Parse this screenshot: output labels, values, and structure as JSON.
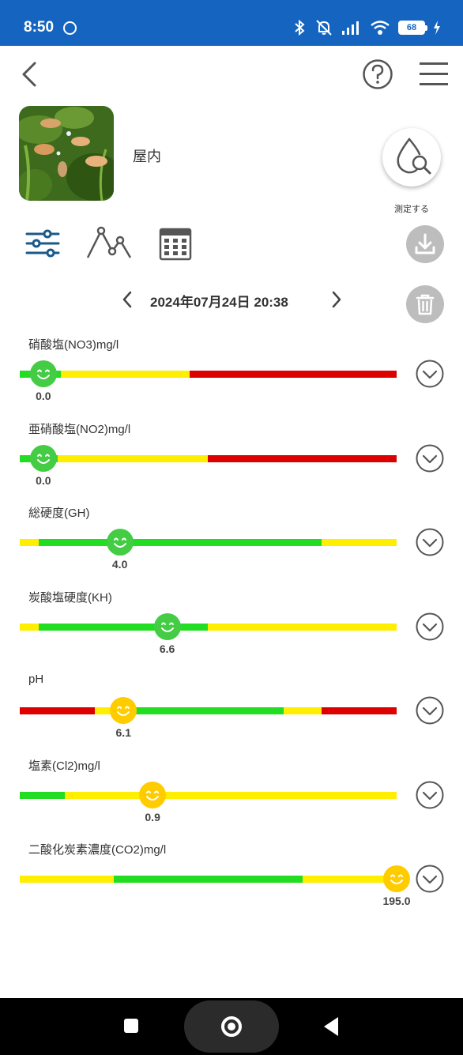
{
  "status_bar": {
    "time": "8:50",
    "battery": "68"
  },
  "header": {
    "tank_name": "屋内",
    "measure_label": "測定する"
  },
  "date_nav": {
    "datetime": "2024年07月24日 20:38"
  },
  "colors": {
    "status_bar": "#1565c0",
    "green": "#22dd22",
    "yellow": "#ffee00",
    "red": "#dd0000",
    "accent_blue": "#1a5a8a",
    "good_knob": "#44cc44",
    "ok_knob": "#ffcc00"
  },
  "params": [
    {
      "label": "硝酸塩(NO3)mg/l",
      "value": "0.0",
      "position": 0.03,
      "status": "good",
      "segments": [
        {
          "color": "green",
          "size": 0.11
        },
        {
          "color": "yellow",
          "size": 0.34
        },
        {
          "color": "red",
          "size": 0.55
        }
      ]
    },
    {
      "label": "亜硝酸塩(NO2)mg/l",
      "value": "0.0",
      "position": 0.03,
      "status": "good",
      "segments": [
        {
          "color": "green",
          "size": 0.1
        },
        {
          "color": "yellow",
          "size": 0.4
        },
        {
          "color": "red",
          "size": 0.5
        }
      ]
    },
    {
      "label": "総硬度(GH)",
      "value": "4.0",
      "position": 0.24,
      "status": "good",
      "segments": [
        {
          "color": "yellow",
          "size": 0.05
        },
        {
          "color": "green",
          "size": 0.75
        },
        {
          "color": "yellow",
          "size": 0.2
        }
      ]
    },
    {
      "label": "炭酸塩硬度(KH)",
      "value": "6.6",
      "position": 0.37,
      "status": "good",
      "segments": [
        {
          "color": "yellow",
          "size": 0.05
        },
        {
          "color": "green",
          "size": 0.45
        },
        {
          "color": "yellow",
          "size": 0.5
        }
      ]
    },
    {
      "label": "pH",
      "value": "6.1",
      "position": 0.25,
      "status": "ok",
      "segments": [
        {
          "color": "red",
          "size": 0.2
        },
        {
          "color": "yellow",
          "size": 0.1
        },
        {
          "color": "green",
          "size": 0.4
        },
        {
          "color": "yellow",
          "size": 0.1
        },
        {
          "color": "red",
          "size": 0.2
        }
      ]
    },
    {
      "label": "塩素(Cl2)mg/l",
      "value": "0.9",
      "position": 0.33,
      "status": "ok",
      "segments": [
        {
          "color": "green",
          "size": 0.12
        },
        {
          "color": "yellow",
          "size": 0.88
        }
      ]
    },
    {
      "label": "二酸化炭素濃度(CO2)mg/l",
      "value": "195.0",
      "position": 1.0,
      "status": "ok",
      "segments": [
        {
          "color": "yellow",
          "size": 0.25
        },
        {
          "color": "green",
          "size": 0.5
        },
        {
          "color": "yellow",
          "size": 0.25
        }
      ]
    }
  ]
}
